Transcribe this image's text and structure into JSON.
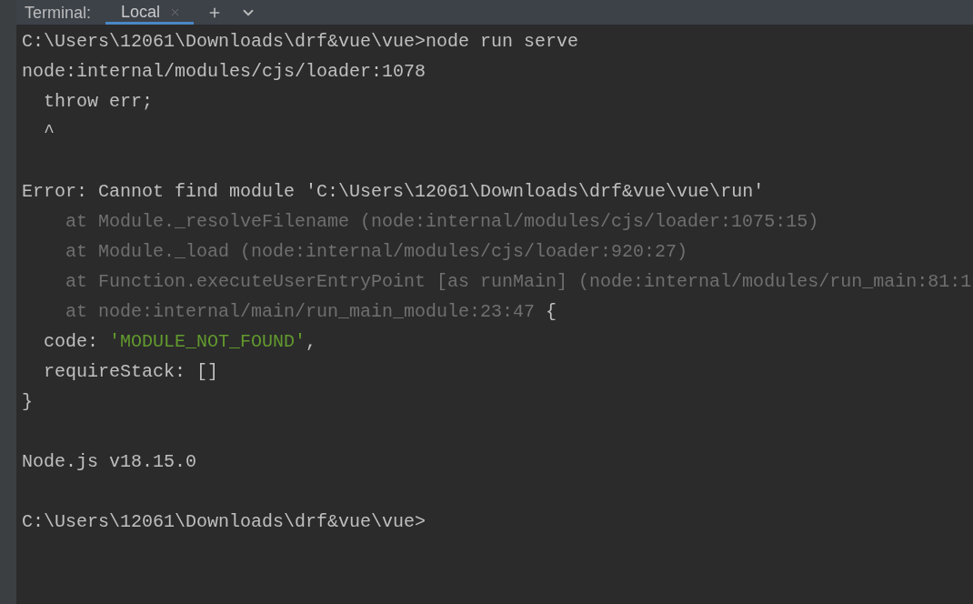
{
  "header": {
    "title": "Terminal:",
    "tabs": [
      {
        "label": "Local",
        "selected": true
      }
    ]
  },
  "terminal": {
    "lines": [
      {
        "kind": "prompt",
        "segments": [
          {
            "text": "C:\\Users\\12061\\Downloads\\drf&vue\\vue>node run serve",
            "kind": "plain"
          }
        ]
      },
      {
        "kind": "output",
        "segments": [
          {
            "text": "node:internal/modules/cjs/loader:1078",
            "kind": "plain"
          }
        ]
      },
      {
        "kind": "nested",
        "segments": [
          {
            "text": "throw err;",
            "kind": "plain"
          }
        ]
      },
      {
        "kind": "nested",
        "segments": [
          {
            "text": "^",
            "kind": "plain"
          }
        ]
      },
      {
        "kind": "blank"
      },
      {
        "kind": "output",
        "segments": [
          {
            "text": "Error: Cannot find module 'C:\\Users\\12061\\Downloads\\drf&vue\\vue\\run'",
            "kind": "plain"
          }
        ]
      },
      {
        "kind": "stack",
        "segments": [
          {
            "text": "at Module._resolveFilename (node:internal/modules/cjs/loader:1075:15)",
            "kind": "dim"
          }
        ]
      },
      {
        "kind": "stack",
        "segments": [
          {
            "text": "at Module._load (node:internal/modules/cjs/loader:920:27)",
            "kind": "dim"
          }
        ]
      },
      {
        "kind": "stack",
        "segments": [
          {
            "text": "at Function.executeUserEntryPoint [as runMain] (node:internal/modules/run_main:81:1",
            "kind": "dim"
          }
        ]
      },
      {
        "kind": "stack",
        "segments": [
          {
            "text": "at node:internal/main/run_main_module:23:47",
            "kind": "dim"
          },
          {
            "text": " {",
            "kind": "plain"
          }
        ]
      },
      {
        "kind": "nested",
        "segments": [
          {
            "text": "code: ",
            "kind": "plain"
          },
          {
            "text": "'MODULE_NOT_FOUND'",
            "kind": "string"
          },
          {
            "text": ",",
            "kind": "plain"
          }
        ]
      },
      {
        "kind": "nested",
        "segments": [
          {
            "text": "requireStack: []",
            "kind": "plain"
          }
        ]
      },
      {
        "kind": "output",
        "segments": [
          {
            "text": "}",
            "kind": "plain"
          }
        ]
      },
      {
        "kind": "blank"
      },
      {
        "kind": "output",
        "segments": [
          {
            "text": "Node.js v18.15.0",
            "kind": "plain"
          }
        ]
      },
      {
        "kind": "blank"
      },
      {
        "kind": "prompt",
        "segments": [
          {
            "text": "C:\\Users\\12061\\Downloads\\drf&vue\\vue>",
            "kind": "plain"
          }
        ]
      }
    ]
  }
}
